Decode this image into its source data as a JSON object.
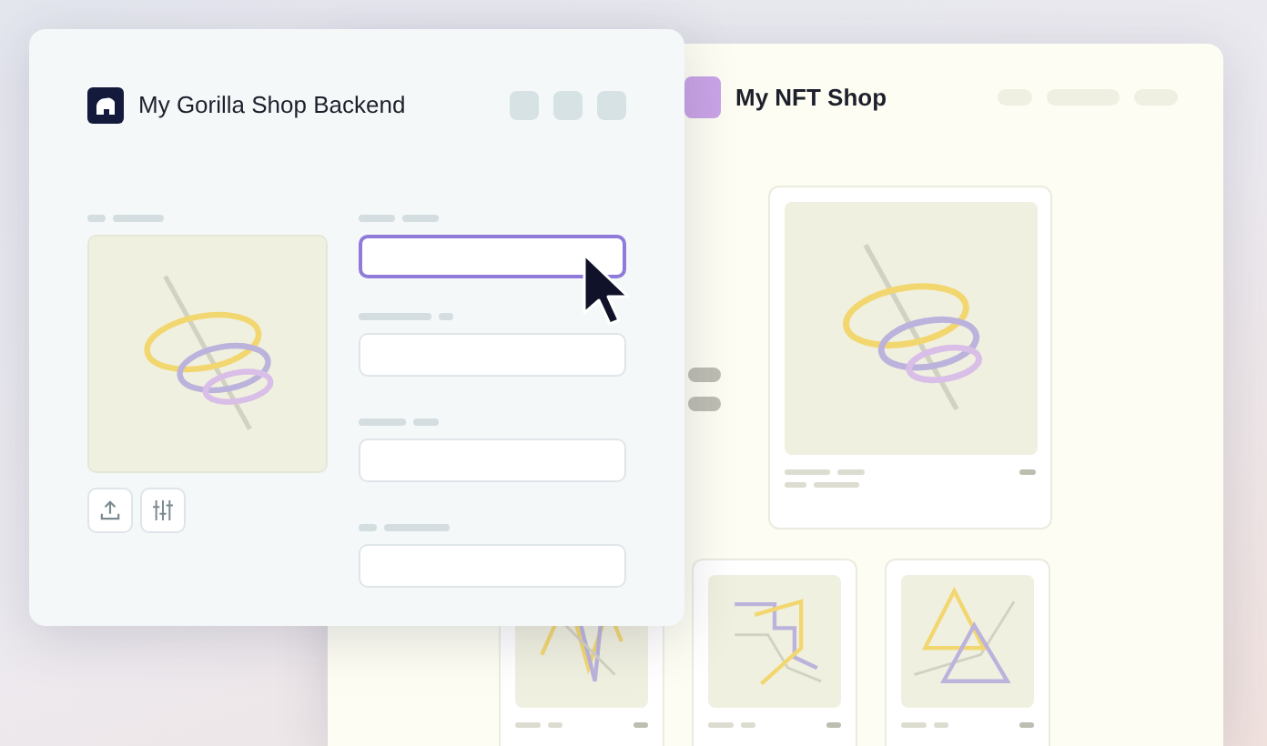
{
  "windows": [
    {
      "kind": "backend",
      "title": "My Gorilla Shop Backend",
      "preview": {
        "kind": "rings"
      },
      "fields": [
        {
          "focused": true
        },
        {
          "focused": false
        },
        {
          "focused": false
        },
        {
          "focused": false
        }
      ]
    },
    {
      "kind": "shop",
      "title": "My NFT Shop",
      "featured": {
        "kind": "rings"
      },
      "thumbnails": [
        {
          "kind": "lines"
        },
        {
          "kind": "steps"
        },
        {
          "kind": "triangles"
        }
      ]
    }
  ]
}
